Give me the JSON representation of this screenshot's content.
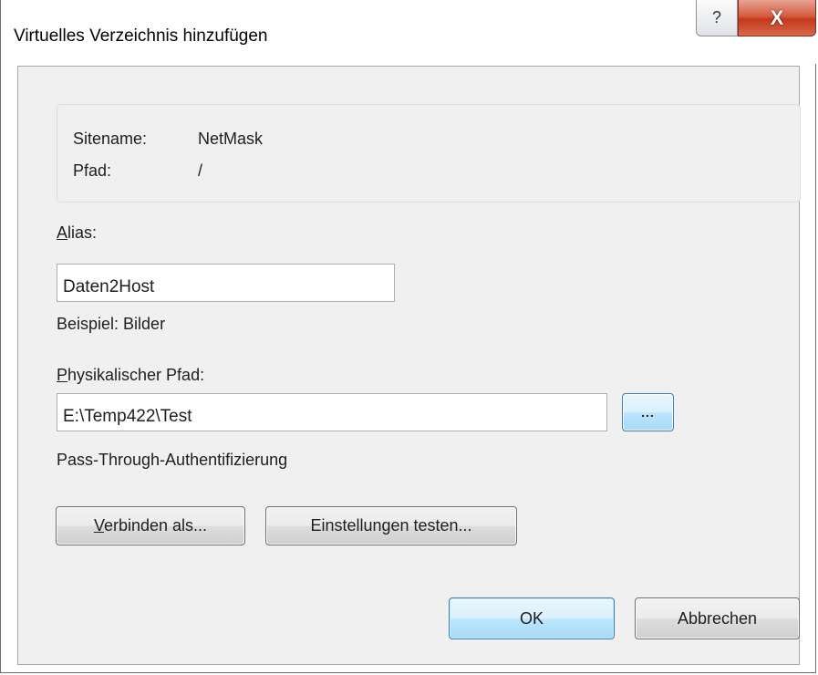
{
  "window": {
    "title": "Virtuelles Verzeichnis hinzufügen",
    "help_glyph": "?",
    "close_glyph": "X"
  },
  "site_info": {
    "sitename_label": "Sitename:",
    "sitename_value": "NetMask",
    "path_label": "Pfad:",
    "path_value": "/"
  },
  "alias": {
    "label_mnemonic": "A",
    "label_rest": "lias:",
    "value": "Daten2Host",
    "example": "Beispiel: Bilder"
  },
  "physical_path": {
    "label_mnemonic": "P",
    "label_rest": "hysikalischer Pfad:",
    "value": "E:\\Temp422\\Test",
    "browse_label": "..."
  },
  "auth": {
    "label": "Pass-Through-Authentifizierung",
    "connect_as_mnemonic": "V",
    "connect_as_rest": "erbinden als...",
    "test_settings_pre": "Einstellun",
    "test_settings_mnemonic": "g",
    "test_settings_post": "en testen..."
  },
  "footer": {
    "ok_label": "OK",
    "cancel_label": "Abbrechen"
  }
}
